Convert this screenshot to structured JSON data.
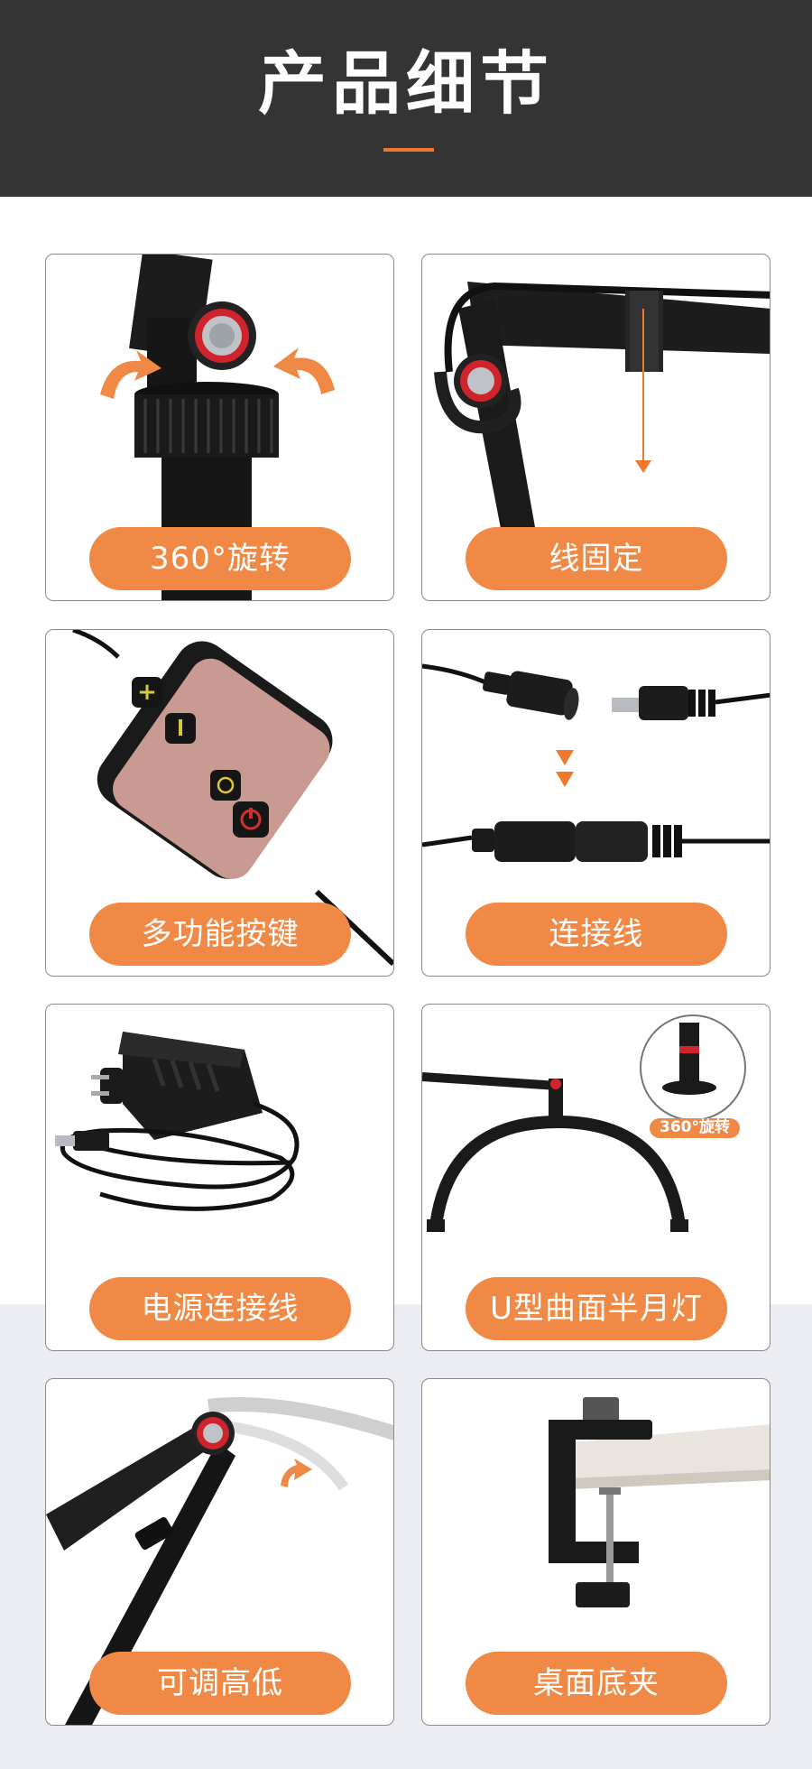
{
  "header": {
    "title": "产品细节",
    "accent_color": "#f0782b",
    "background": "#343434"
  },
  "pill_color": "#ef8945",
  "cards": [
    {
      "label": "360°旋转",
      "icon": "rotation-joint-photo"
    },
    {
      "label": "线固定",
      "icon": "cable-strap-photo"
    },
    {
      "label": "多功能按键",
      "icon": "button-remote-photo"
    },
    {
      "label": "连接线",
      "icon": "connector-cable-photo"
    },
    {
      "label": "电源连接线",
      "icon": "power-adapter-photo"
    },
    {
      "label": "U型曲面半月灯",
      "icon": "half-moon-lamp-photo",
      "badge": "360°旋转"
    },
    {
      "label": "可调高低",
      "icon": "adjustable-arm-photo"
    },
    {
      "label": "桌面底夹",
      "icon": "desk-clamp-photo"
    }
  ]
}
